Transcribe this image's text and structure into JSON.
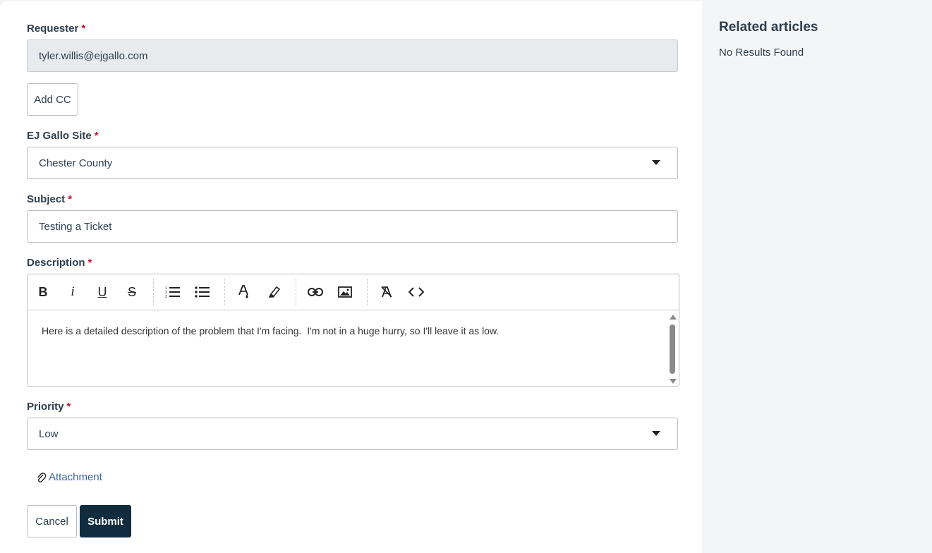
{
  "form": {
    "requester": {
      "label": "Requester",
      "required": "*",
      "value": "tyler.willis@ejgallo.com"
    },
    "add_cc_label": "Add CC",
    "site": {
      "label": "EJ Gallo Site",
      "required": "*",
      "value": "Chester County"
    },
    "subject": {
      "label": "Subject",
      "required": "*",
      "value": "Testing a Ticket"
    },
    "description": {
      "label": "Description",
      "required": "*",
      "value": "Here is a detailed description of the problem that I'm facing.  I'm not in a huge hurry, so I'll leave it as low.",
      "toolbar": {
        "bold": "B",
        "italic": "i",
        "underline": "U",
        "strike": "S"
      }
    },
    "priority": {
      "label": "Priority",
      "required": "*",
      "value": "Low"
    },
    "attachment_label": "Attachment",
    "cancel_label": "Cancel",
    "submit_label": "Submit"
  },
  "sidebar": {
    "title": "Related articles",
    "empty_text": "No Results Found"
  },
  "colors": {
    "primary_button": "#112b3f",
    "required_marker": "#c8102e",
    "link": "#3d64a6"
  }
}
